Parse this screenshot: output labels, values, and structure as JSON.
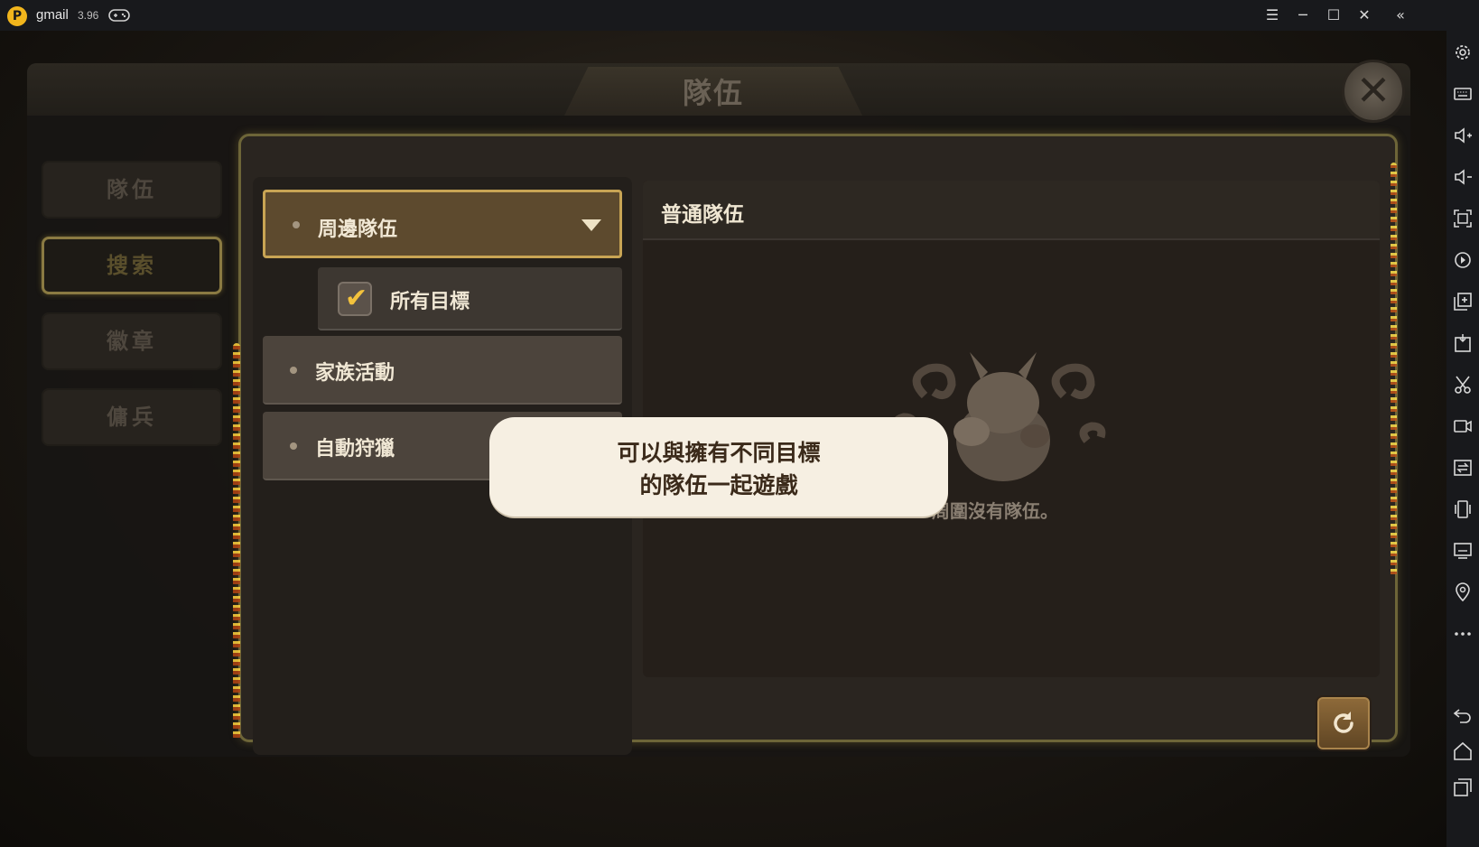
{
  "window": {
    "app_title": "gmail",
    "version": "3.96",
    "controls": [
      "menu",
      "minimize",
      "maximize",
      "close",
      "collapse-sidebar"
    ]
  },
  "game": {
    "page_title": "隊伍",
    "tabs": [
      {
        "label": "隊伍",
        "active": false
      },
      {
        "label": "搜索",
        "active": true
      },
      {
        "label": "徽章",
        "active": false
      },
      {
        "label": "傭兵",
        "active": false
      }
    ],
    "filters": {
      "dropdown_label": "周邊隊伍",
      "sub_option_label": "所有目標",
      "sub_option_checked": true,
      "options": [
        "家族活動",
        "自動狩獵"
      ]
    },
    "list": {
      "title": "普通隊伍",
      "empty_text": "周圍沒有隊伍。"
    },
    "tooltip": {
      "line1": "可以與擁有不同目標",
      "line2": "的隊伍一起遊戲"
    }
  },
  "sidebar_icons": [
    "settings-icon",
    "keyboard-icon",
    "volume-up-icon",
    "volume-down-icon",
    "screenshot-icon",
    "record-replay-icon",
    "multi-instance-icon",
    "apk-install-icon",
    "scissors-icon",
    "video-record-icon",
    "sync-icon",
    "shake-icon",
    "display-icon",
    "location-icon",
    "more-icon",
    "back-icon",
    "home-icon",
    "recent-apps-icon"
  ],
  "colors": {
    "accent_gold": "#c8a454",
    "check_yellow": "#f3c23c",
    "emulator_bg": "#18191c"
  }
}
